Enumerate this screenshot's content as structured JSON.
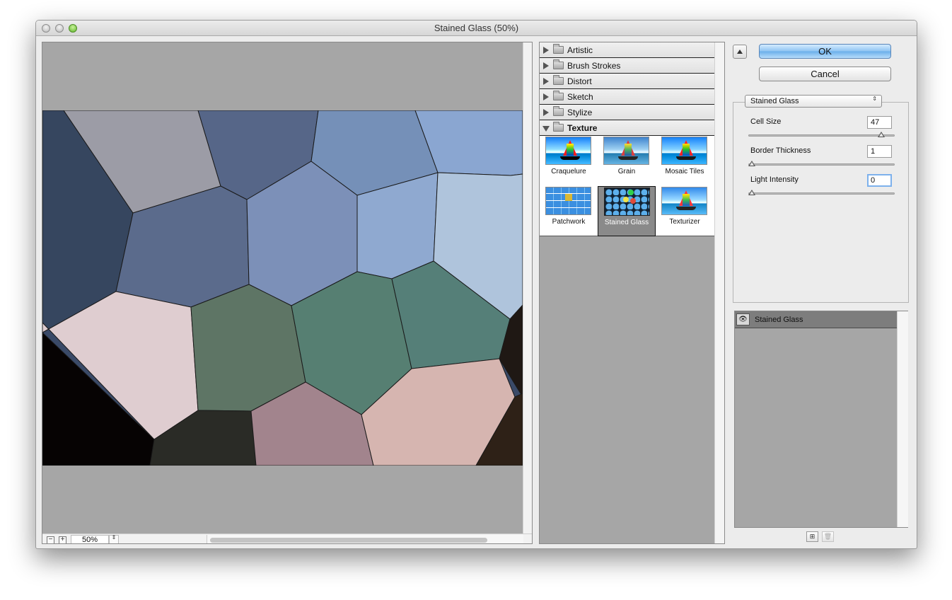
{
  "window": {
    "title": "Stained Glass (50%)"
  },
  "preview": {
    "zoom": "50%",
    "zoom_out_label": "−",
    "zoom_in_label": "+",
    "stepper_label": "⇕"
  },
  "categories": [
    {
      "label": "Artistic",
      "expanded": false
    },
    {
      "label": "Brush Strokes",
      "expanded": false
    },
    {
      "label": "Distort",
      "expanded": false
    },
    {
      "label": "Sketch",
      "expanded": false
    },
    {
      "label": "Stylize",
      "expanded": false
    },
    {
      "label": "Texture",
      "expanded": true
    }
  ],
  "texture_filters": [
    {
      "label": "Craquelure",
      "selected": false
    },
    {
      "label": "Grain",
      "selected": false
    },
    {
      "label": "Mosaic Tiles",
      "selected": false
    },
    {
      "label": "Patchwork",
      "selected": false
    },
    {
      "label": "Stained Glass",
      "selected": true
    },
    {
      "label": "Texturizer",
      "selected": false
    }
  ],
  "buttons": {
    "ok": "OK",
    "cancel": "Cancel"
  },
  "settings": {
    "filter_name": "Stained Glass",
    "select_arrow": "⇕",
    "params": [
      {
        "label": "Cell Size",
        "value": "47",
        "slider_fraction": 0.93
      },
      {
        "label": "Border Thickness",
        "value": "1",
        "slider_fraction": 0.0
      },
      {
        "label": "Light Intensity",
        "value": "0",
        "slider_fraction": 0.0
      }
    ]
  },
  "layers": [
    {
      "name": "Stained Glass",
      "visible": true,
      "eye_icon": "👁"
    }
  ],
  "layer_buttons": {
    "new_icon": "⊞",
    "delete_icon": "🗑"
  },
  "colors": {
    "ok_button": "#8ec4f2",
    "preview_bg": "#a6a6a6"
  }
}
